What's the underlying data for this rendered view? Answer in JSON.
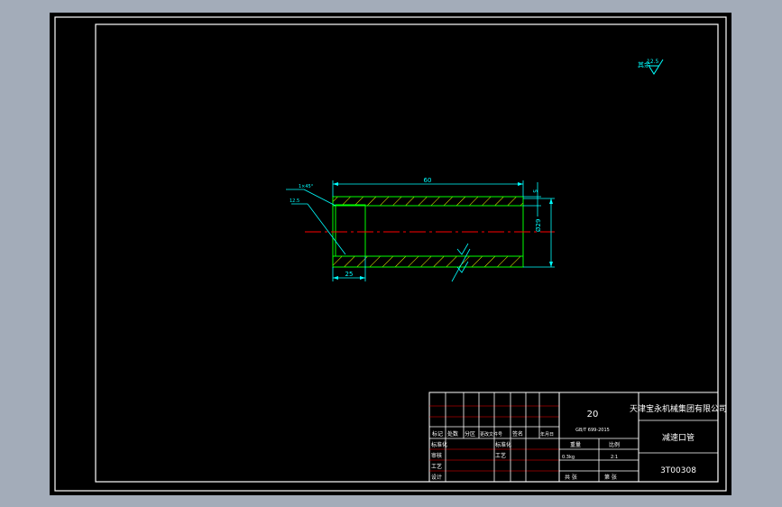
{
  "drawing": {
    "surface_finish": {
      "label": "其余",
      "value": "12.5"
    },
    "part": {
      "dim_length": "60",
      "dim_wall": "5",
      "dim_diameter": "Ø29",
      "dim_bore_depth": "25",
      "chamfer_note": "1×45°",
      "leader_note": "12.5"
    }
  },
  "title_block": {
    "material": "20",
    "standard": "GB/T 699-2015",
    "company": "天津宝永机械集团有限公司",
    "part_name": "减速口管",
    "drawing_no": "3T00308",
    "row_labels": {
      "mark": "标记",
      "count": "处数",
      "zone": "分区",
      "change_doc": "更改文件号",
      "signature": "签名",
      "date": "年月日"
    },
    "left_labels": [
      "标准化",
      "审核",
      "工艺",
      "设计"
    ],
    "mid_labels": [
      "标准化",
      "工艺"
    ],
    "weight_label": "重量",
    "scale_label": "比例",
    "weight_value": "0.3kg",
    "scale_value": "2:1",
    "sheets_total": "共 张",
    "sheet_no": "第 张"
  },
  "colors": {
    "frame": "#ffffff",
    "outline": "#00ff00",
    "dimension": "#00ffff",
    "hatch": "#ffff00",
    "centerline": "#ff0000",
    "table_red": "#ff0000"
  }
}
